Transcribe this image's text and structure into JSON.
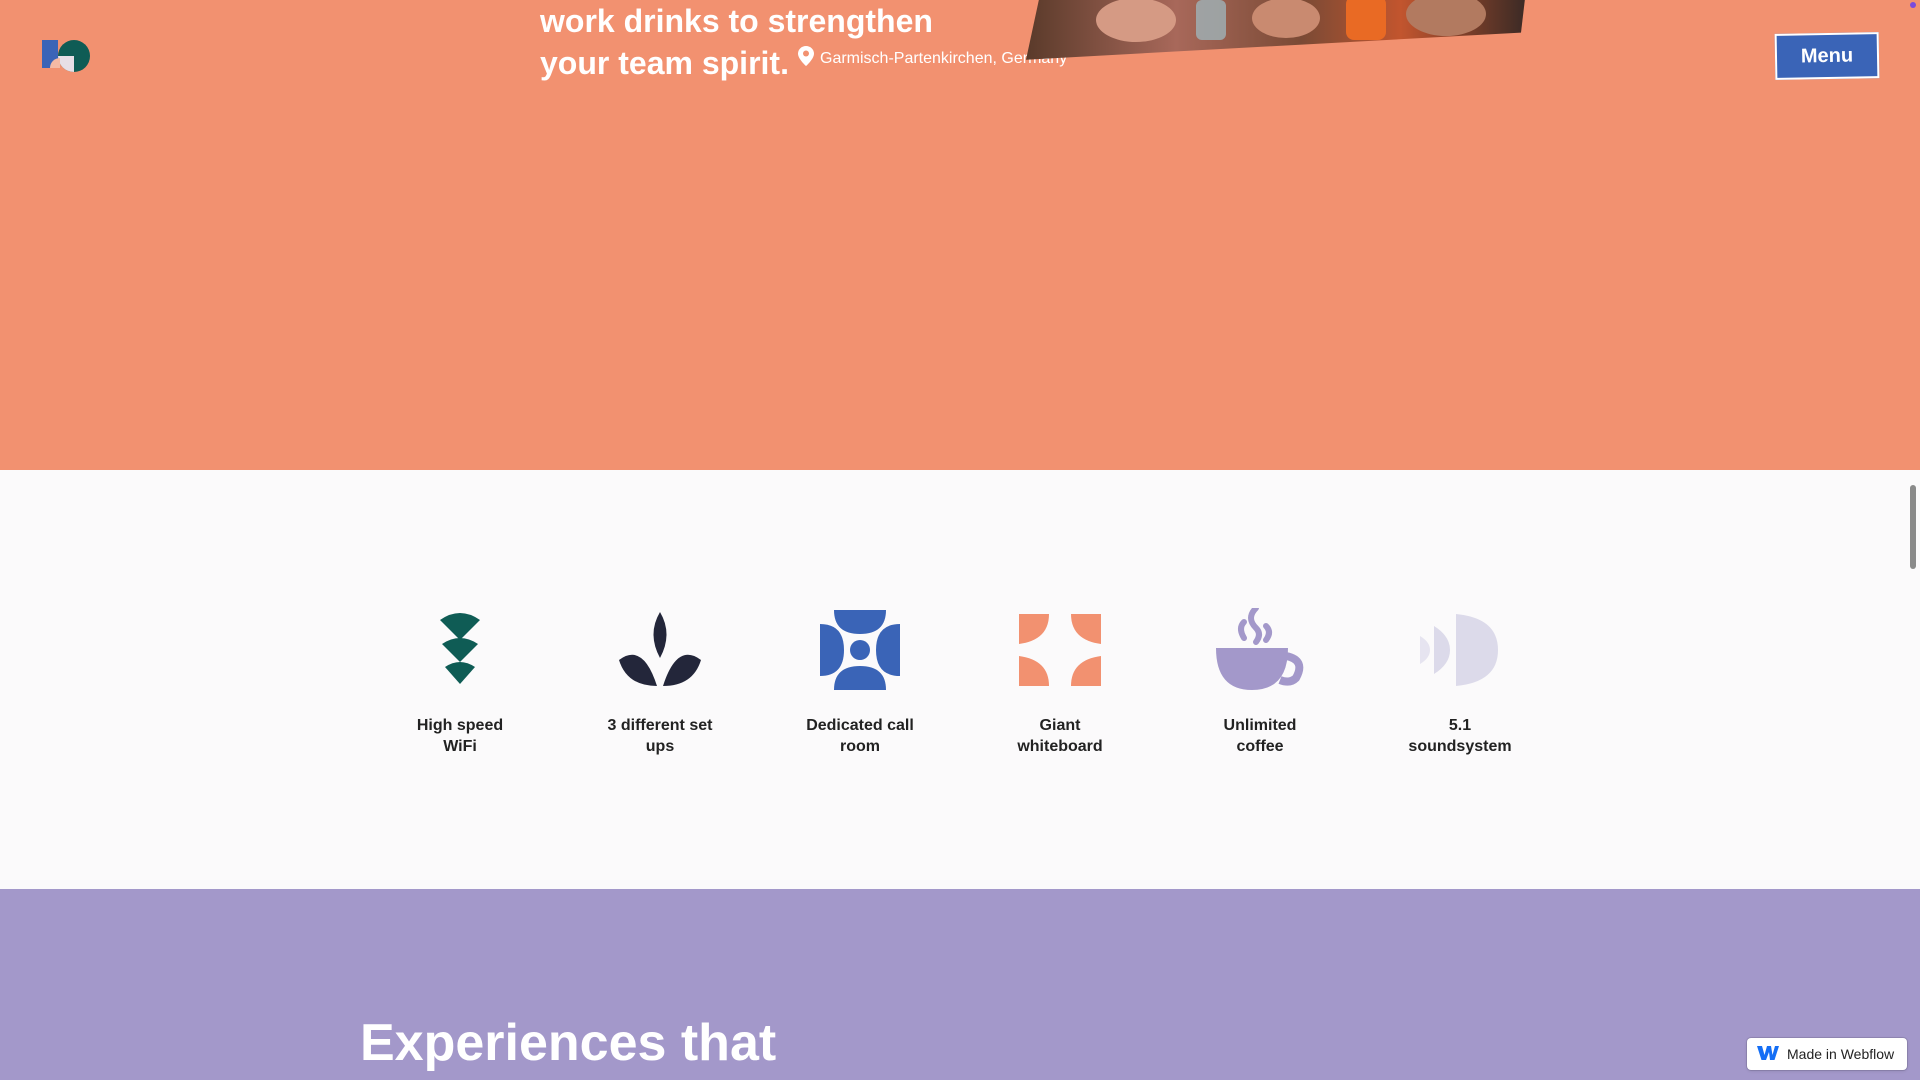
{
  "hero": {
    "heading_lines": [
      "work drinks to strengthen",
      "your team spirit."
    ],
    "location": "Garmisch-Partenkirchen, Germany",
    "menu_label": "Menu",
    "background_color": "#f29170"
  },
  "amenities": {
    "items": [
      {
        "label": "High speed\nWiFi",
        "icon": "wifi-icon",
        "color": "#0f5c55"
      },
      {
        "label": "3 different set\nups",
        "icon": "leaves-icon",
        "color": "#23263a"
      },
      {
        "label": "Dedicated call\nroom",
        "icon": "call-room-icon",
        "color": "#3a64b7"
      },
      {
        "label": "Giant\nwhiteboard",
        "icon": "whiteboard-icon",
        "color": "#f29170"
      },
      {
        "label": "Unlimited\ncoffee",
        "icon": "coffee-cup-icon",
        "color": "#a398ca"
      },
      {
        "label": "5.1\nsoundsystem",
        "icon": "speaker-icon",
        "color": "#dcdaea"
      }
    ]
  },
  "experiences": {
    "heading": "Experiences that",
    "background_color": "#a398ca"
  },
  "badge": {
    "label": "Made in Webflow"
  }
}
